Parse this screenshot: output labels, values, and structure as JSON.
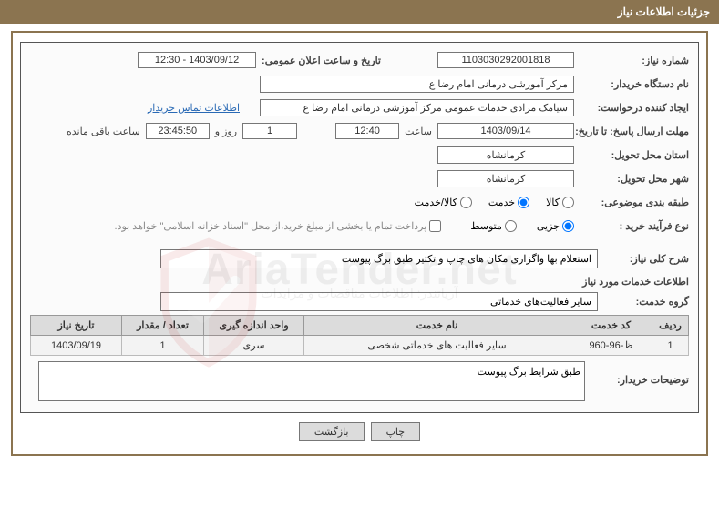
{
  "page_title": "جزئیات اطلاعات نیاز",
  "labels": {
    "need_number": "شماره نیاز:",
    "announce_date": "تاریخ و ساعت اعلان عمومی:",
    "buyer_org": "نام دستگاه خریدار:",
    "creator": "ایجاد کننده درخواست:",
    "contact_link": "اطلاعات تماس خریدار",
    "deadline": "مهلت ارسال پاسخ: تا تاریخ:",
    "time_word": "ساعت",
    "days_and": "روز و",
    "time_remain": "ساعت باقی مانده",
    "province": "استان محل تحویل:",
    "city": "شهر محل تحویل:",
    "subject_class": "طبقه بندی موضوعی:",
    "purchase_type": "نوع فرآیند خرید :",
    "treasury_note": "پرداخت تمام یا بخشی از مبلغ خرید،از محل \"اسناد خزانه اسلامی\" خواهد بود.",
    "need_desc": "شرح کلی نیاز:",
    "services_info": "اطلاعات خدمات مورد نیاز",
    "service_group": "گروه خدمت:",
    "buyer_notes": "توضیحات خریدار:"
  },
  "values": {
    "need_number": "1103030292001818",
    "announce_date": "1403/09/12 - 12:30",
    "buyer_org": "مرکز آموزشی  درمانی امام رضا  ع",
    "creator": "سیامک مرادی خدمات عمومی مرکز آموزشی  درمانی امام رضا  ع",
    "deadline_date": "1403/09/14",
    "deadline_time": "12:40",
    "remain_days": "1",
    "remain_hms": "23:45:50",
    "province": "کرمانشاه",
    "city": "کرمانشاه",
    "need_desc": "استعلام بها واگزاری مکان های چاپ و تکثیر طبق برگ پیوست",
    "service_group": "سایر فعالیت‌های خدماتی",
    "buyer_notes": "طبق شرایط برگ پیوست"
  },
  "subject_class": {
    "options": [
      "کالا",
      "خدمت",
      "کالا/خدمت"
    ],
    "selected": 1
  },
  "purchase_type": {
    "options": [
      "جزیی",
      "متوسط"
    ],
    "selected": 0
  },
  "grid": {
    "headers": [
      "ردیف",
      "کد خدمت",
      "نام خدمت",
      "واحد اندازه گیری",
      "تعداد / مقدار",
      "تاریخ نیاز"
    ],
    "rows": [
      {
        "idx": "1",
        "code": "ظ-96-960",
        "name": "سایر فعالیت های خدماتی شخصی",
        "unit": "سری",
        "qty": "1",
        "date": "1403/09/19"
      }
    ]
  },
  "buttons": {
    "print": "چاپ",
    "back": "بازگشت"
  },
  "watermark": {
    "main": "AriaTender.net",
    "sub": "آریاتندر: اطلاعات مناقصات و مزایدات"
  }
}
